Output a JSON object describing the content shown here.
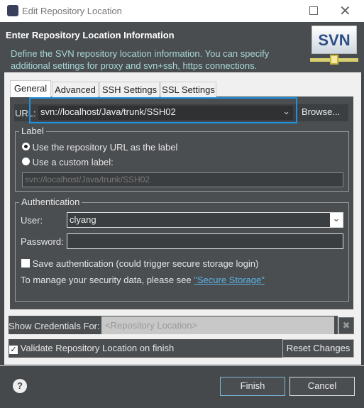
{
  "window": {
    "title": "Edit Repository Location",
    "icon": "eclipse-icon",
    "controls": [
      "maximize-icon",
      "close-icon"
    ]
  },
  "header": {
    "title": "Enter Repository Location Information",
    "description_1": "Define the SVN repository location information. You can specify",
    "description_2": "additional settings for proxy and svn+ssh, https connections.",
    "logo": "SVN"
  },
  "tabs": [
    {
      "label": "General",
      "selected": true
    },
    {
      "label": "Advanced"
    },
    {
      "label": "SSH Settings"
    },
    {
      "label": "SSL Settings"
    }
  ],
  "url": {
    "label": "URL:",
    "value": "svn://localhost/Java/trunk/SSH02",
    "browse": "Browse..."
  },
  "label_group": {
    "title": "Label",
    "opt_url": "Use the repository URL as the label",
    "opt_custom": "Use a custom label:",
    "custom_value": "svn://localhost/Java/trunk/SSH02",
    "selected": "url"
  },
  "auth": {
    "title": "Authentication",
    "user_label": "User:",
    "user_value": "clyang",
    "password_label": "Password:",
    "password_value": "",
    "save_label": "Save authentication (could trigger secure storage login)",
    "save_checked": false,
    "manage_text": "To manage your security data, please see ",
    "link": "\"Secure Storage\""
  },
  "credentials": {
    "label": "Show Credentials For:",
    "value": "<Repository Location>"
  },
  "validate": {
    "label": "Validate Repository Location on finish",
    "checked": true
  },
  "reset": "Reset Changes",
  "footer": {
    "finish": "Finish",
    "cancel": "Cancel"
  },
  "colors": {
    "accent": "#1e90e0",
    "link": "#5ab4e6"
  }
}
